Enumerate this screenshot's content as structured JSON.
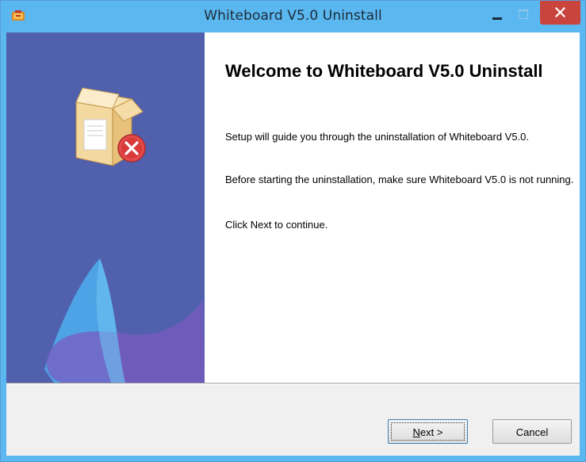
{
  "window": {
    "title": "Whiteboard V5.0 Uninstall"
  },
  "content": {
    "heading": "Welcome to Whiteboard V5.0 Uninstall",
    "paragraphs": [
      "Setup will guide you through the uninstallation of Whiteboard V5.0.",
      "Before starting the uninstallation, make sure Whiteboard V5.0 is not running.",
      "Click Next to continue."
    ]
  },
  "buttons": {
    "next_mnemonic": "N",
    "next_rest": "ext >",
    "cancel": "Cancel"
  },
  "icons": {
    "app": "app-icon",
    "uninstall": "uninstall-box-icon",
    "minimize": "minimize-icon",
    "maximize": "maximize-icon",
    "close": "close-icon"
  },
  "colors": {
    "titlebar": "#5ab7ef",
    "sidebar": "#5060ad",
    "close": "#c9443d"
  }
}
